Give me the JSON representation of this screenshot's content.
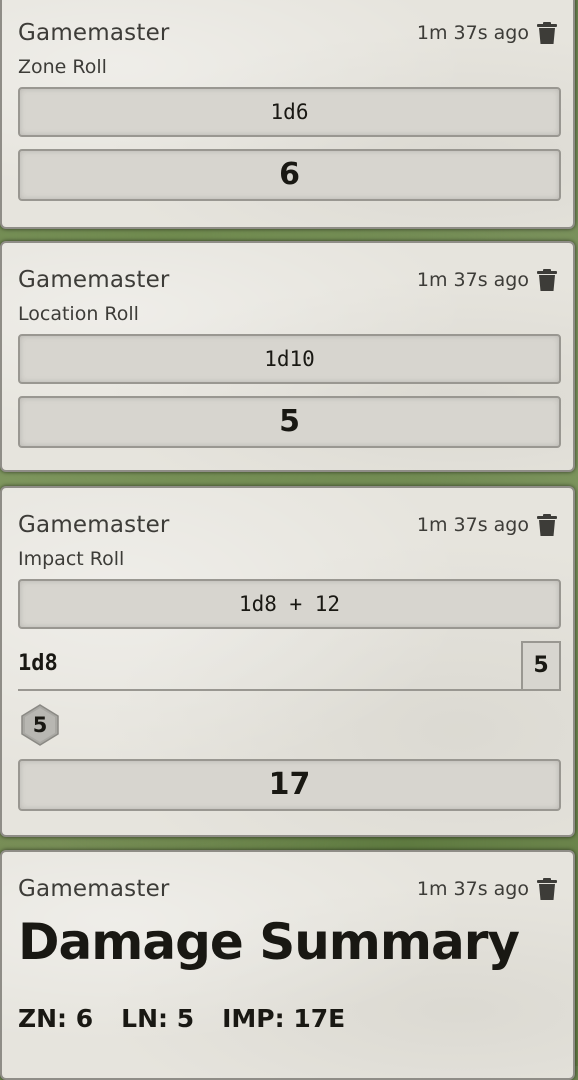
{
  "messages": [
    {
      "sender": "Gamemaster",
      "timestamp": "1m 37s ago",
      "flavor": "Zone Roll",
      "formula": "1d6",
      "total": "6"
    },
    {
      "sender": "Gamemaster",
      "timestamp": "1m 37s ago",
      "flavor": "Location Roll",
      "formula": "1d10",
      "total": "5"
    },
    {
      "sender": "Gamemaster",
      "timestamp": "1m 37s ago",
      "flavor": "Impact Roll",
      "formula": "1d8 + 12",
      "part_formula": "1d8",
      "part_total": "5",
      "die_value": "5",
      "total": "17"
    },
    {
      "sender": "Gamemaster",
      "timestamp": "1m 37s ago",
      "title": "Damage Summary",
      "stats": [
        "ZN: 6",
        "LN: 5",
        "IMP: 17E"
      ]
    }
  ],
  "icons": {
    "delete": "trash-icon",
    "die": "d8-die-icon"
  },
  "colors": {
    "card_background": "#e6e4dd",
    "card_border": "#8f8d87",
    "roll_box": "#d7d5cf",
    "text": "#191813"
  }
}
